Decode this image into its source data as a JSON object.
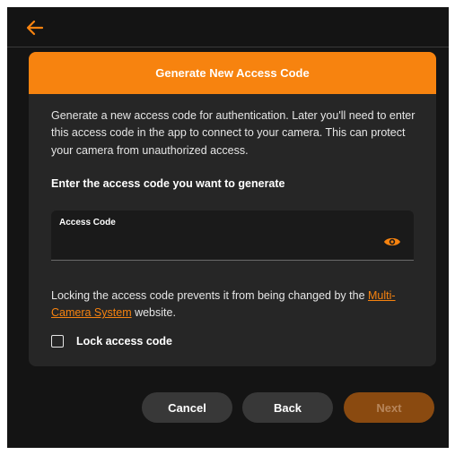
{
  "colors": {
    "accent": "#f7830f",
    "background": "#141414",
    "dialog": "#262626",
    "next_disabled": "#8a4a10"
  },
  "topbar": {
    "back_icon": "arrow-left-icon"
  },
  "dialog": {
    "title": "Generate New Access Code",
    "description": "Generate a new access code for authentication. Later you'll need to enter this access code in the app to connect to your camera. This can protect your camera from unauthorized access.",
    "prompt": "Enter the access code you want to generate",
    "field": {
      "label": "Access Code",
      "value": "",
      "placeholder": "",
      "toggle_icon": "eye-icon"
    },
    "lock_note": {
      "text": "Locking the access code prevents it from being changed by the ",
      "link": "Multi-Camera System",
      "suffix": " website."
    },
    "checkbox": {
      "label": "Lock access code",
      "checked": false
    }
  },
  "buttons": {
    "cancel": "Cancel",
    "back": "Back",
    "next": "Next"
  }
}
